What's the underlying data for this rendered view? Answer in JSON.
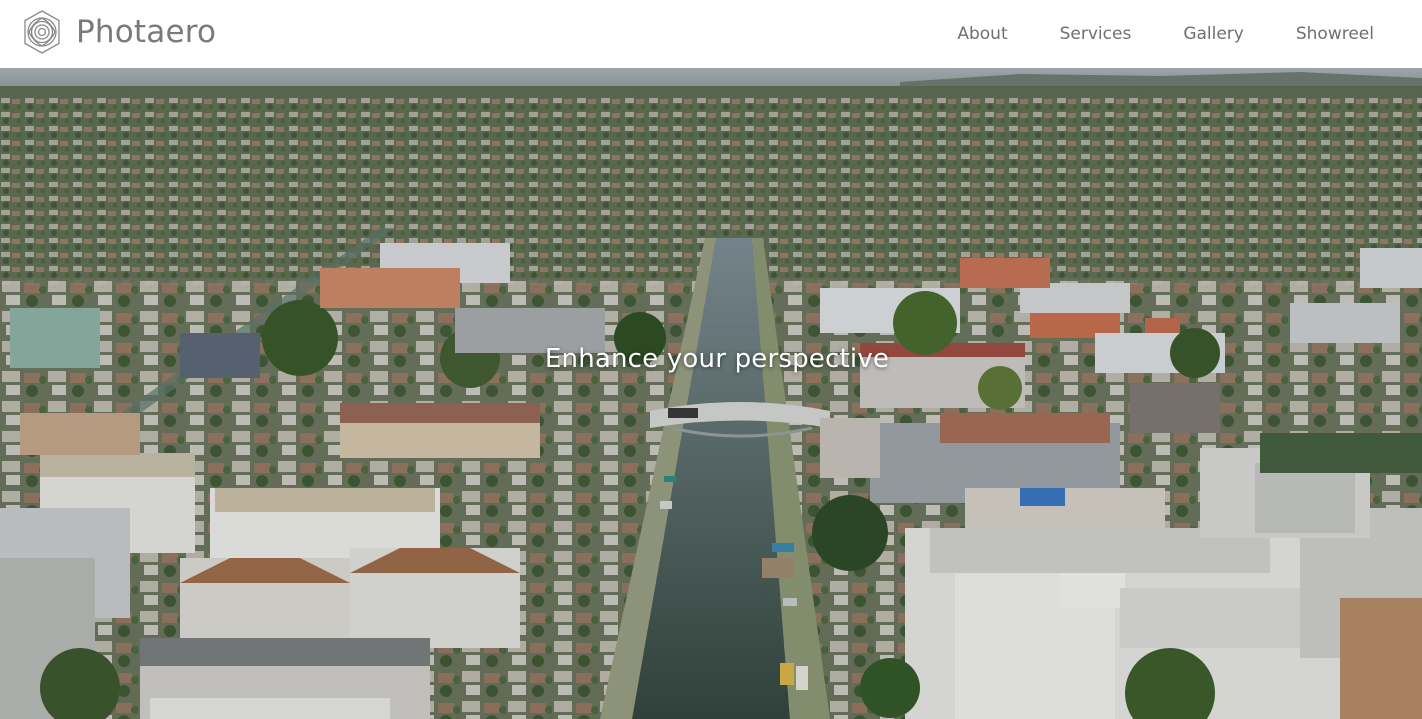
{
  "brand": {
    "name": "Photaero",
    "logo_icon": "aperture-logo-icon"
  },
  "nav": {
    "items": [
      {
        "label": "About"
      },
      {
        "label": "Services"
      },
      {
        "label": "Gallery"
      },
      {
        "label": "Showreel"
      }
    ]
  },
  "hero": {
    "tagline": "Enhance your perspective",
    "image_subject": "aerial-canal-neighborhood-photo"
  },
  "colors": {
    "header_bg": "#ffffff",
    "brand_text": "#7a7a7a",
    "nav_text": "#6f6f6f",
    "tagline_text": "#ffffff"
  }
}
